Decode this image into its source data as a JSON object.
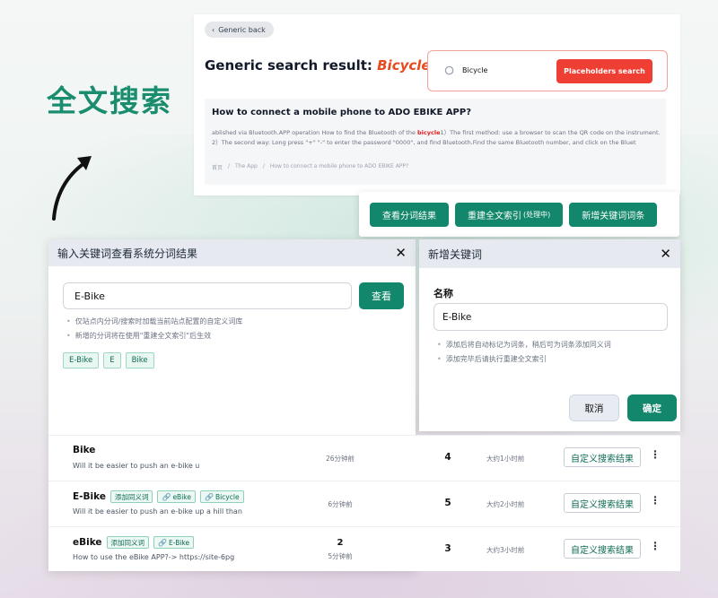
{
  "hero": {
    "title": "全文搜索"
  },
  "search_card": {
    "back_label": "Generic back",
    "title_prefix": "Generic search result: ",
    "title_keyword": "Bicycle",
    "search_value": "Bicycle",
    "search_button": "Placeholders search",
    "result": {
      "title": "How to connect a mobile phone to ADO EBIKE APP?",
      "snippet_before": "ablished via Bluetooth.APP operation How to find the Bluetooth of the ",
      "snippet_highlight": "bicycle",
      "snippet_after": "1）The first method: use a browser to scan the QR code on the instrument. 2）The second way: Long press \"+\" \"-\" to enter the password \"0000\", and find Bluetooth.Find the same Bluetooth number, and click on the Bluet",
      "crumbs": [
        "首页",
        "/",
        "The App",
        "/",
        "How to connect a mobile phone to ADO EBIKE APP?"
      ]
    }
  },
  "button_bar": {
    "view_segments": "查看分词结果",
    "rebuild_index": "重建全文索引",
    "rebuild_status": "(处理中)",
    "add_keyword": "新增关键词词条"
  },
  "segment_dialog": {
    "title": "输入关键词查看系统分词结果",
    "close": "✕",
    "input_value": "E-Bike",
    "view_button": "查看",
    "hints": [
      "仅站点内分词/搜索时加载当前站点配置的自定义词库",
      "新增的分词将在使用\"重建全文索引\"后生效"
    ],
    "tokens": [
      "E-Bike",
      "E",
      "Bike"
    ]
  },
  "keyword_dialog": {
    "title": "新增关键词",
    "close": "✕",
    "name_label": "名称",
    "name_value": "E-Bike",
    "hints": [
      "添加后将自动标记为词条，稍后可为词条添加同义词",
      "添加完毕后请执行重建全文索引"
    ],
    "cancel": "取消",
    "confirm": "确定"
  },
  "keyword_table": {
    "rows": [
      {
        "name": "Bike",
        "tags": [],
        "desc": "Will it be easier to push an e-bike u",
        "count_top": "",
        "created": "26分钟前",
        "hits": "4",
        "updated": "大约1小时前",
        "action": "自定义搜索结果"
      },
      {
        "name": "E-Bike",
        "tags": [
          {
            "text": "添加同义词",
            "link": false
          },
          {
            "text": "eBike",
            "link": true
          },
          {
            "text": "Bicycle",
            "link": true
          }
        ],
        "desc": "Will it be easier to push an e-bike up a hill than",
        "count_top": "",
        "created": "6分钟前",
        "hits": "5",
        "updated": "大约2小时前",
        "action": "自定义搜索结果"
      },
      {
        "name": "eBike",
        "tags": [
          {
            "text": "添加同义词",
            "link": false
          },
          {
            "text": "E-Bike",
            "link": true
          }
        ],
        "desc": "How to use the eBike APP?-> https://site-6pg",
        "count_top": "2",
        "created": "5分钟前",
        "hits": "3",
        "updated": "大约3小时前",
        "action": "自定义搜索结果"
      }
    ],
    "more_icon": "⋮",
    "link_icon": "🔗"
  },
  "colors": {
    "accent": "#13876c",
    "danger": "#ef3e33",
    "keyword": "#e84a1f"
  }
}
